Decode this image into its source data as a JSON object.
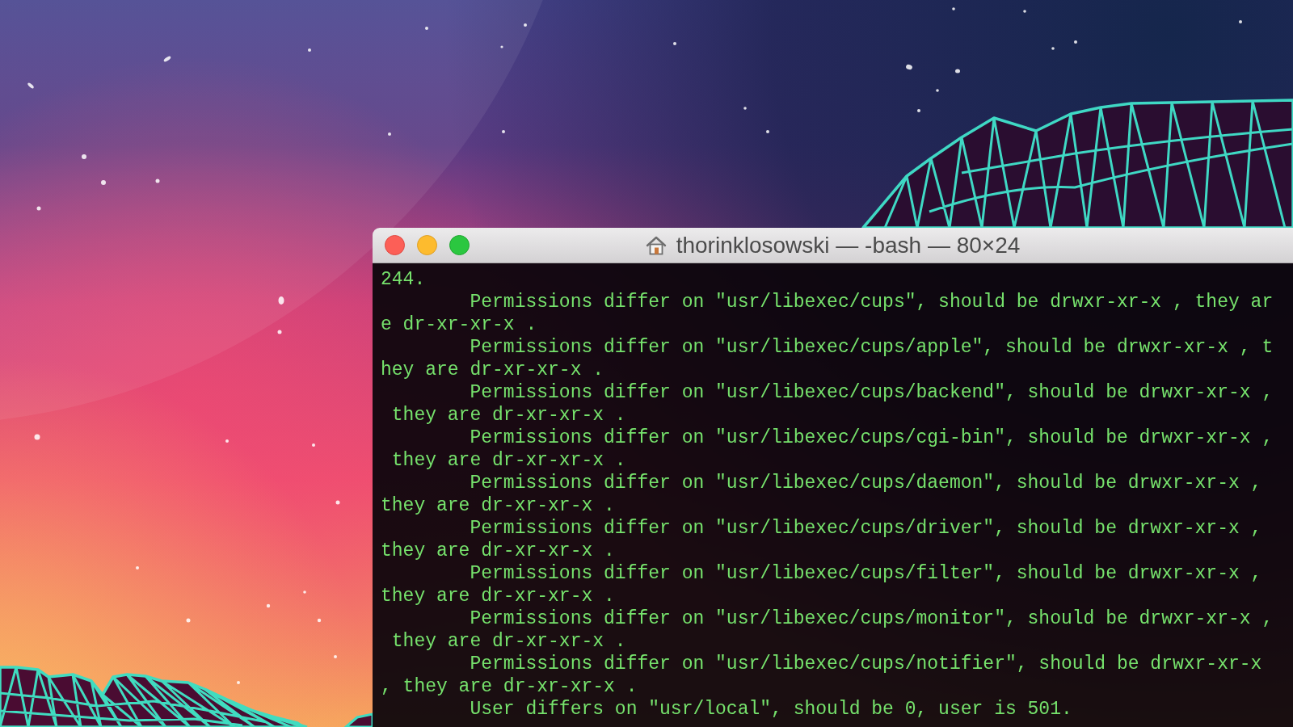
{
  "window": {
    "title": "thorinklosowski — -bash — 80×24"
  },
  "terminal": {
    "lines": [
      "244.",
      "\tPermissions differ on \"usr/libexec/cups\", should be drwxr-xr-x , they are dr-xr-xr-x .",
      "\tPermissions differ on \"usr/libexec/cups/apple\", should be drwxr-xr-x , they are dr-xr-xr-x .",
      "\tPermissions differ on \"usr/libexec/cups/backend\", should be drwxr-xr-x , they are dr-xr-xr-x .",
      "\tPermissions differ on \"usr/libexec/cups/cgi-bin\", should be drwxr-xr-x , they are dr-xr-xr-x .",
      "\tPermissions differ on \"usr/libexec/cups/daemon\", should be drwxr-xr-x , they are dr-xr-xr-x .",
      "\tPermissions differ on \"usr/libexec/cups/driver\", should be drwxr-xr-x , they are dr-xr-xr-x .",
      "\tPermissions differ on \"usr/libexec/cups/filter\", should be drwxr-xr-x , they are dr-xr-xr-x .",
      "\tPermissions differ on \"usr/libexec/cups/monitor\", should be drwxr-xr-x , they are dr-xr-xr-x .",
      "\tPermissions differ on \"usr/libexec/cups/notifier\", should be drwxr-xr-x , they are dr-xr-xr-x .",
      "\tUser differs on \"usr/local\", should be 0, user is 501."
    ]
  }
}
